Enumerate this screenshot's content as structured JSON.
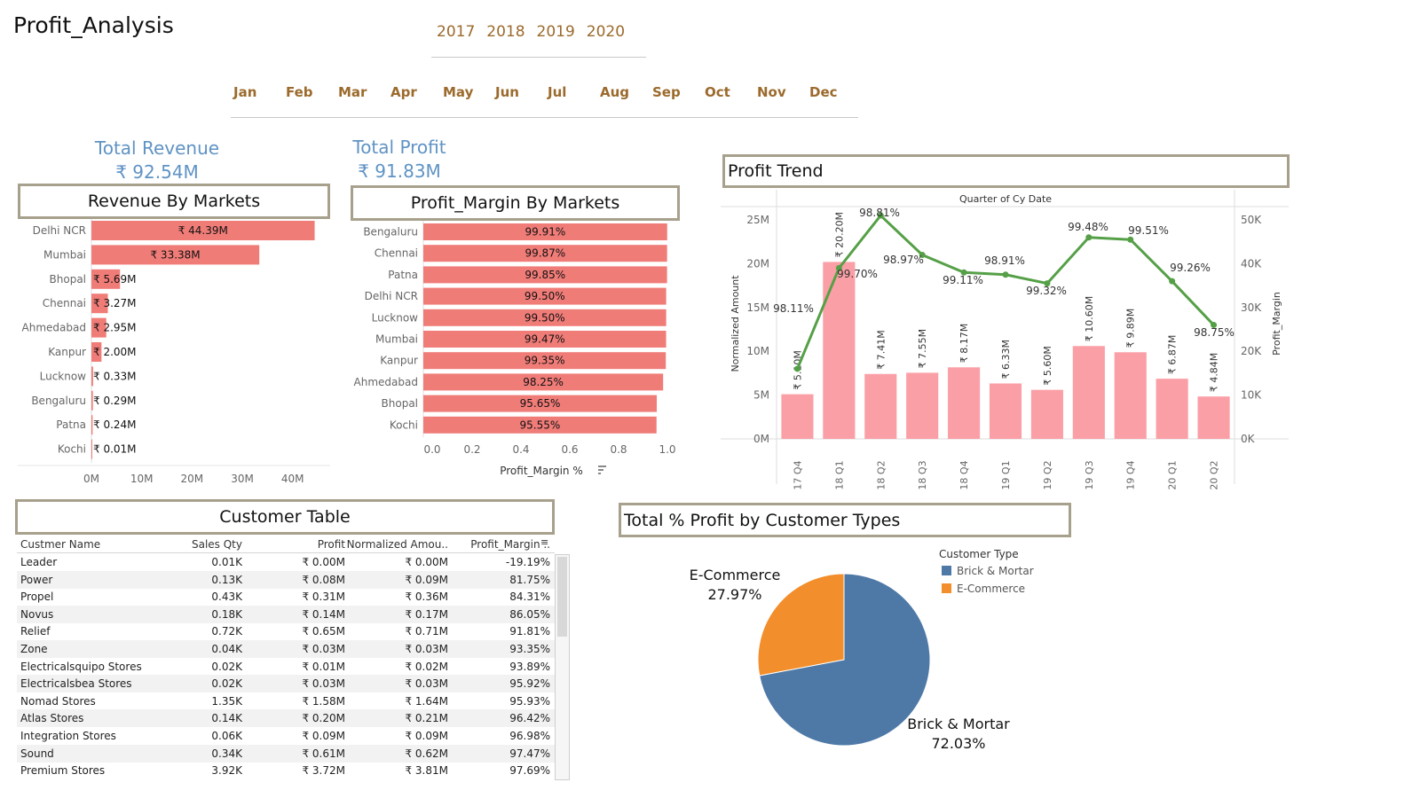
{
  "title": "Profit_Analysis",
  "filters": {
    "years": [
      "2017",
      "2018",
      "2019",
      "2020"
    ],
    "months": [
      "Jan",
      "Feb",
      "Mar",
      "Apr",
      "May",
      "Jun",
      "Jul",
      "Aug",
      "Sep",
      "Oct",
      "Nov",
      "Dec"
    ]
  },
  "kpis": {
    "revenue_label": "Total Revenue",
    "revenue_value": "₹ 92.54M",
    "profit_label": "Total Profit",
    "profit_value": "₹ 91.83M"
  },
  "headers": {
    "revenue_markets": "Revenue By Markets",
    "margin_markets": "Profit_Margin By Markets",
    "profit_trend": "Profit Trend",
    "customer_table": "Customer Table",
    "customer_types": "Total % Profit by Customer Types"
  },
  "colors": {
    "bar_red": "#f07c78",
    "bar_pink": "#fb9fa6",
    "line_green": "#55a047",
    "pie_blue": "#4e79a7",
    "pie_orange": "#f28e2b",
    "frame": "#a7a08c",
    "accent_brown": "#9b6a2c",
    "kpi_blue": "#5f93c4"
  },
  "chart_data": [
    {
      "id": "revenue_by_markets",
      "type": "bar",
      "orientation": "horizontal",
      "categories": [
        "Delhi NCR",
        "Mumbai",
        "Bhopal",
        "Chennai",
        "Ahmedabad",
        "Kanpur",
        "Lucknow",
        "Bengaluru",
        "Patna",
        "Kochi"
      ],
      "values": [
        44.39,
        33.38,
        5.69,
        3.27,
        2.95,
        2.0,
        0.33,
        0.29,
        0.24,
        0.01
      ],
      "labels": [
        "₹ 44.39M",
        "₹ 33.38M",
        "₹ 5.69M",
        "₹ 3.27M",
        "₹ 2.95M",
        "₹ 2.00M",
        "₹ 0.33M",
        "₹ 0.29M",
        "₹ 0.24M",
        "₹ 0.01M"
      ],
      "xticks": [
        "0M",
        "10M",
        "20M",
        "30M",
        "40M"
      ],
      "xlim": [
        0,
        45
      ],
      "unit": "M"
    },
    {
      "id": "profit_margin_by_markets",
      "type": "bar",
      "orientation": "horizontal",
      "categories": [
        "Bengaluru",
        "Chennai",
        "Patna",
        "Delhi NCR",
        "Lucknow",
        "Mumbai",
        "Kanpur",
        "Ahmedabad",
        "Bhopal",
        "Kochi"
      ],
      "values": [
        0.9991,
        0.9987,
        0.9985,
        0.995,
        0.995,
        0.9947,
        0.9935,
        0.9825,
        0.9565,
        0.9555
      ],
      "labels": [
        "99.91%",
        "99.87%",
        "99.85%",
        "99.50%",
        "99.50%",
        "99.47%",
        "99.35%",
        "98.25%",
        "95.65%",
        "95.55%"
      ],
      "xticks": [
        "0.0",
        "0.2",
        "0.4",
        "0.6",
        "0.8",
        "1.0"
      ],
      "xlim": [
        0,
        1.0
      ],
      "xlabel": "Profit_Margin %"
    },
    {
      "id": "profit_trend",
      "type": "bar",
      "title": "Quarter of Cy Date",
      "categories": [
        "2017 Q4",
        "2018 Q1",
        "2018 Q2",
        "2018 Q3",
        "2018 Q4",
        "2019 Q1",
        "2019 Q2",
        "2019 Q3",
        "2019 Q4",
        "2020 Q1",
        "2020 Q2"
      ],
      "bar_values": [
        5.1,
        20.2,
        7.41,
        7.55,
        8.17,
        6.33,
        5.6,
        10.6,
        9.89,
        6.87,
        4.84
      ],
      "bar_labels": [
        "₹ 5.10M",
        "₹ 20.20M",
        "₹ 7.41M",
        "₹ 7.55M",
        "₹ 8.17M",
        "₹ 6.33M",
        "₹ 5.60M",
        "₹ 10.60M",
        "₹ 9.89M",
        "₹ 6.87M",
        "₹ 4.84M"
      ],
      "line_values": [
        98.11,
        99.7,
        98.81,
        98.97,
        99.11,
        98.91,
        99.32,
        99.48,
        99.51,
        99.26,
        98.75
      ],
      "line_labels": [
        "98.11%",
        "99.70%",
        "98.81%",
        "98.97%",
        "99.11%",
        "98.91%",
        "99.32%",
        "99.48%",
        "99.51%",
        "99.26%",
        "98.75%"
      ],
      "line_points_right_axis": [
        16000,
        39000,
        51000,
        42000,
        38000,
        37500,
        35500,
        46000,
        45500,
        36000,
        26000
      ],
      "ylabel": "Normalized Amount",
      "yticks": [
        "0M",
        "5M",
        "10M",
        "15M",
        "20M",
        "25M"
      ],
      "ylim": [
        0,
        25
      ],
      "y2label": "Profit_Margin",
      "y2ticks": [
        "0K",
        "10K",
        "20K",
        "30K",
        "40K",
        "50K"
      ],
      "y2lim": [
        0,
        50000
      ]
    },
    {
      "id": "profit_by_customer_types",
      "type": "pie",
      "legend_title": "Customer Type",
      "legend_position": "top-right",
      "slices": [
        {
          "name": "Brick & Mortar",
          "value": 72.03,
          "label": "72.03%"
        },
        {
          "name": "E-Commerce",
          "value": 27.97,
          "label": "27.97%"
        }
      ]
    }
  ],
  "customer_table": {
    "columns": [
      "Custmer Name",
      "Sales Qty",
      "Profit",
      "Normalized Amou..",
      "Profit_Margin .."
    ],
    "rows": [
      [
        "Leader",
        "0.01K",
        "₹ 0.00M",
        "₹ 0.00M",
        "-19.19%"
      ],
      [
        "Power",
        "0.13K",
        "₹ 0.08M",
        "₹ 0.09M",
        "81.75%"
      ],
      [
        "Propel",
        "0.43K",
        "₹ 0.31M",
        "₹ 0.36M",
        "84.31%"
      ],
      [
        "Novus",
        "0.18K",
        "₹ 0.14M",
        "₹ 0.17M",
        "86.05%"
      ],
      [
        "Relief",
        "0.72K",
        "₹ 0.65M",
        "₹ 0.71M",
        "91.81%"
      ],
      [
        "Zone",
        "0.04K",
        "₹ 0.03M",
        "₹ 0.03M",
        "93.35%"
      ],
      [
        "Electricalsquipo Stores",
        "0.02K",
        "₹ 0.01M",
        "₹ 0.02M",
        "93.89%"
      ],
      [
        "Electricalsbea Stores",
        "0.02K",
        "₹ 0.03M",
        "₹ 0.03M",
        "95.92%"
      ],
      [
        "Nomad Stores",
        "1.35K",
        "₹ 1.58M",
        "₹ 1.64M",
        "95.93%"
      ],
      [
        "Atlas Stores",
        "0.14K",
        "₹ 0.20M",
        "₹ 0.21M",
        "96.42%"
      ],
      [
        "Integration Stores",
        "0.06K",
        "₹ 0.09M",
        "₹ 0.09M",
        "96.98%"
      ],
      [
        "Sound",
        "0.34K",
        "₹ 0.61M",
        "₹ 0.62M",
        "97.47%"
      ],
      [
        "Premium Stores",
        "3.92K",
        "₹ 3.72M",
        "₹ 3.81M",
        "97.69%"
      ]
    ]
  }
}
